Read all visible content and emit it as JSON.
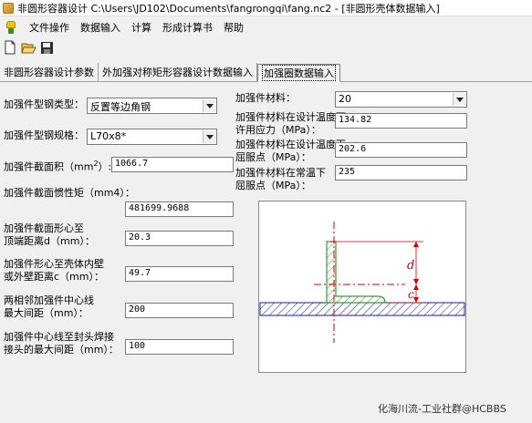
{
  "window": {
    "title": "非圆形容器设计 C:\\Users\\JD102\\Documents\\fangrongqi\\fang.nc2 - [非圆形壳体数据输入]"
  },
  "menu": [
    "文件操作",
    "数据输入",
    "计算",
    "形成计算书",
    "帮助"
  ],
  "toolbar": {
    "icons": [
      "new-file-icon",
      "open-folder-icon",
      "save-disk-icon"
    ]
  },
  "tabs": [
    {
      "label": "非圆形容器设计参数",
      "active": false
    },
    {
      "label": "外加强对称矩形容器设计数据输入",
      "active": false
    },
    {
      "label": "加强圈数据输入",
      "active": true
    }
  ],
  "left": {
    "steel_type": {
      "label": "加强件型钢类型：",
      "value": "反置等边角钢"
    },
    "steel_spec": {
      "label": "加强件型钢规格：",
      "value": "L70x8*"
    },
    "area": {
      "label": "加强件截面积（mm",
      "label_sup": "2",
      "label_end": "）:",
      "value": "1066.7"
    },
    "inertia": {
      "label": "加强件截面惯性矩（mm4）：",
      "value": "481699.9688"
    },
    "centroid_top": {
      "label1": "加强件截面形心至",
      "label2": "顶端距离d（mm）：",
      "value": "20.3"
    },
    "centroid_wall": {
      "label1": "加强件形心至壳体内壁",
      "label2": "或外壁距离c（mm）：",
      "value": "49.7"
    },
    "spacing": {
      "label1": "两相邻加强件中心线",
      "label2": "最大间距（mm）：",
      "value": "200"
    },
    "weld_spacing": {
      "label1": "加强件中心线至封头焊接",
      "label2": "接头的最大间距（mm）：",
      "value": "100"
    }
  },
  "right": {
    "material": {
      "label": "加强件材料：",
      "value": "20"
    },
    "allow_stress": {
      "label1": "加强件材料在设计温度下",
      "label2": "许用应力（MPa）：",
      "value": "134.82"
    },
    "yield_design": {
      "label1": "加强件材料在设计温度下",
      "label2": "屈服点（MPa）：",
      "value": "202.6"
    },
    "yield_room": {
      "label1": "加强件材料在常温下",
      "label2": "屈服点（MPa）：",
      "value": "235"
    }
  },
  "drawing": {
    "label_d": "d",
    "label_c": "c"
  },
  "watermark": "化海川流-工业社群@HCBBS"
}
